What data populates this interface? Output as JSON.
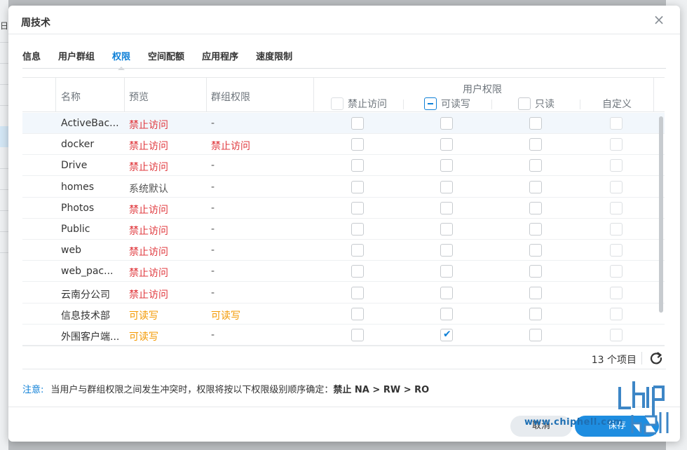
{
  "dialog": {
    "title": "周技术",
    "close": "×"
  },
  "tabs": [
    {
      "label": "信息",
      "active": false
    },
    {
      "label": "用户群组",
      "active": false
    },
    {
      "label": "权限",
      "active": true
    },
    {
      "label": "空间配额",
      "active": false
    },
    {
      "label": "应用程序",
      "active": false
    },
    {
      "label": "速度限制",
      "active": false
    }
  ],
  "grid": {
    "headers": {
      "name": "名称",
      "preview": "预览",
      "group_perm": "群组权限",
      "user_perm": "用户权限",
      "deny": "禁止访问",
      "rw": "可读写",
      "ro": "只读",
      "custom": "自定义"
    },
    "rows": [
      {
        "name": "ActiveBac...",
        "preview": "禁止访问",
        "preview_type": "red",
        "group": "-",
        "group_type": "gray",
        "deny": false,
        "rw": false,
        "ro": false,
        "custom": false
      },
      {
        "name": "docker",
        "preview": "禁止访问",
        "preview_type": "red",
        "group": "禁止访问",
        "group_type": "red",
        "deny": false,
        "rw": false,
        "ro": false,
        "custom": false
      },
      {
        "name": "Drive",
        "preview": "禁止访问",
        "preview_type": "red",
        "group": "-",
        "group_type": "gray",
        "deny": false,
        "rw": false,
        "ro": false,
        "custom": false
      },
      {
        "name": "homes",
        "preview": "系统默认",
        "preview_type": "gray",
        "group": "-",
        "group_type": "gray",
        "deny": false,
        "rw": false,
        "ro": false,
        "custom": false
      },
      {
        "name": "Photos",
        "preview": "禁止访问",
        "preview_type": "red",
        "group": "-",
        "group_type": "gray",
        "deny": false,
        "rw": false,
        "ro": false,
        "custom": false
      },
      {
        "name": "Public",
        "preview": "禁止访问",
        "preview_type": "red",
        "group": "-",
        "group_type": "gray",
        "deny": false,
        "rw": false,
        "ro": false,
        "custom": false
      },
      {
        "name": "web",
        "preview": "禁止访问",
        "preview_type": "red",
        "group": "-",
        "group_type": "gray",
        "deny": false,
        "rw": false,
        "ro": false,
        "custom": false
      },
      {
        "name": "web_pac...",
        "preview": "禁止访问",
        "preview_type": "red",
        "group": "-",
        "group_type": "gray",
        "deny": false,
        "rw": false,
        "ro": false,
        "custom": false
      },
      {
        "name": "云南分公司",
        "preview": "禁止访问",
        "preview_type": "red",
        "group": "-",
        "group_type": "gray",
        "deny": false,
        "rw": false,
        "ro": false,
        "custom": false
      },
      {
        "name": "信息技术部",
        "preview": "可读写",
        "preview_type": "orange",
        "group": "可读写",
        "group_type": "orange",
        "deny": false,
        "rw": false,
        "ro": false,
        "custom": false
      },
      {
        "name": "外围客户端...",
        "preview": "可读写",
        "preview_type": "orange",
        "group": "-",
        "group_type": "gray",
        "deny": false,
        "rw": true,
        "ro": false,
        "custom": false
      }
    ]
  },
  "footer": {
    "count": "13 个项目"
  },
  "note": {
    "label": "注意:",
    "text": "当用户与群组权限之间发生冲突时，权限将按以下权限级别顺序确定：",
    "strong": "禁止 NA > RW > RO"
  },
  "buttons": {
    "cancel": "取消",
    "save": "保存"
  },
  "watermark": "www.chiphell.com",
  "colors": {
    "accent": "#0f80d7",
    "deny": "#e0393e",
    "rw": "#f39800"
  }
}
